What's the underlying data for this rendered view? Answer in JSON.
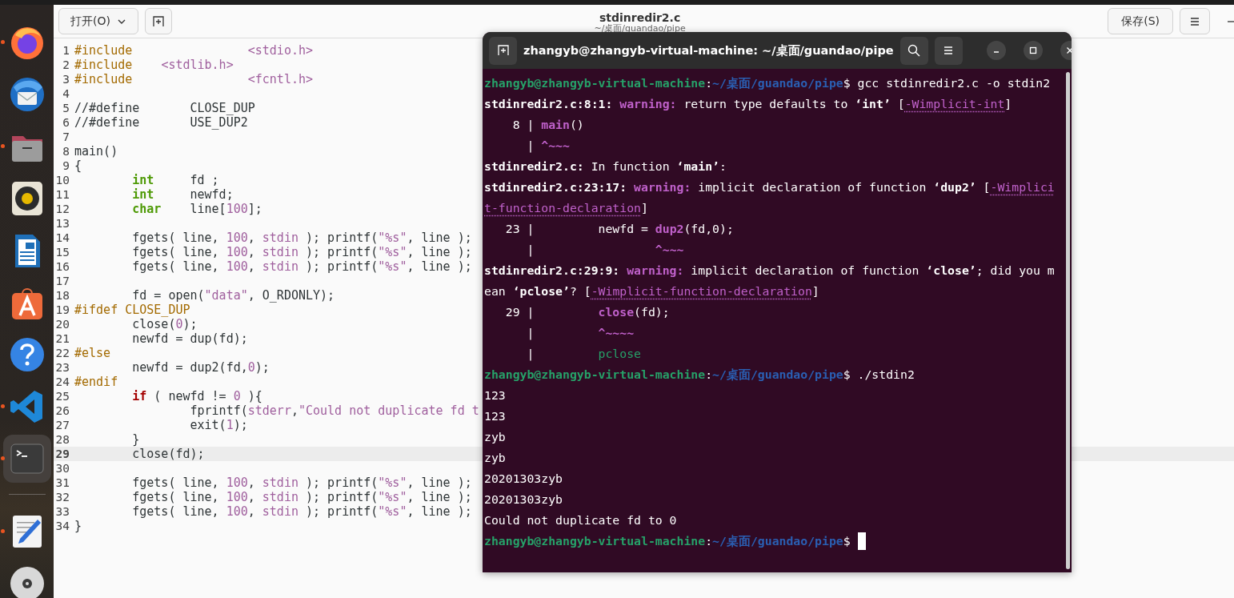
{
  "dock": [
    {
      "kind": "browser",
      "running": true,
      "selected": false
    },
    {
      "kind": "mail",
      "running": false,
      "selected": false
    },
    {
      "kind": "files",
      "running": true,
      "selected": false
    },
    {
      "kind": "music",
      "running": false,
      "selected": false
    },
    {
      "kind": "writer",
      "running": false,
      "selected": false
    },
    {
      "kind": "store",
      "running": false,
      "selected": false
    },
    {
      "kind": "help",
      "running": false,
      "selected": false
    },
    {
      "kind": "code",
      "running": true,
      "selected": false
    },
    {
      "kind": "terminal",
      "running": true,
      "selected": true
    },
    {
      "kind": "separator"
    },
    {
      "kind": "editor",
      "running": true,
      "selected": false
    },
    {
      "kind": "disc",
      "running": false,
      "selected": false
    }
  ],
  "editor": {
    "open_button": "打开(O)",
    "title": "stdinredir2.c",
    "subtitle": "~/桌面/guandao/pipe",
    "save_button": "保存(S)",
    "lines": [
      {
        "number": "1",
        "current": false,
        "segments": [
          {
            "kind": "pre",
            "text": "#include\t\t"
          },
          {
            "kind": "str",
            "text": "<stdio.h>"
          }
        ]
      },
      {
        "number": "2",
        "current": false,
        "segments": [
          {
            "kind": "pre",
            "text": "#include    "
          },
          {
            "kind": "str",
            "text": "<stdlib.h>"
          }
        ]
      },
      {
        "number": "3",
        "current": false,
        "segments": [
          {
            "kind": "pre",
            "text": "#include\t\t"
          },
          {
            "kind": "str",
            "text": "<fcntl.h>"
          }
        ]
      },
      {
        "number": "4",
        "current": false
      },
      {
        "number": "5",
        "current": false,
        "segments": [
          {
            "kind": "plain",
            "text": "//#define\tCLOSE_DUP"
          }
        ]
      },
      {
        "number": "6",
        "current": false,
        "segments": [
          {
            "kind": "plain",
            "text": "//#define\tUSE_DUP2"
          }
        ]
      },
      {
        "number": "7",
        "current": false
      },
      {
        "number": "8",
        "current": false,
        "segments": [
          {
            "kind": "plain",
            "text": "main()"
          }
        ]
      },
      {
        "number": "9",
        "current": false,
        "segments": [
          {
            "kind": "plain",
            "text": "{"
          }
        ]
      },
      {
        "number": "10",
        "current": false,
        "segments": [
          {
            "kind": "type",
            "text": "\tint"
          },
          {
            "kind": "plain",
            "text": "\tfd ;"
          }
        ]
      },
      {
        "number": "11",
        "current": false,
        "segments": [
          {
            "kind": "type",
            "text": "\tint"
          },
          {
            "kind": "plain",
            "text": "\tnewfd;"
          }
        ]
      },
      {
        "number": "12",
        "current": false,
        "segments": [
          {
            "kind": "type",
            "text": "\tchar"
          },
          {
            "kind": "plain",
            "text": "\tline["
          },
          {
            "kind": "num",
            "text": "100"
          },
          {
            "kind": "plain",
            "text": "];"
          }
        ]
      },
      {
        "number": "13",
        "current": false
      },
      {
        "number": "14",
        "current": false,
        "segments": [
          {
            "kind": "plain",
            "text": "\tfgets( line, "
          },
          {
            "kind": "num",
            "text": "100"
          },
          {
            "kind": "plain",
            "text": ", "
          },
          {
            "kind": "str",
            "text": "stdin"
          },
          {
            "kind": "plain",
            "text": " ); printf("
          },
          {
            "kind": "str",
            "text": "\"%s\""
          },
          {
            "kind": "plain",
            "text": ", line );"
          }
        ]
      },
      {
        "number": "15",
        "current": false,
        "segments": [
          {
            "kind": "plain",
            "text": "\tfgets( line, "
          },
          {
            "kind": "num",
            "text": "100"
          },
          {
            "kind": "plain",
            "text": ", "
          },
          {
            "kind": "str",
            "text": "stdin"
          },
          {
            "kind": "plain",
            "text": " ); printf("
          },
          {
            "kind": "str",
            "text": "\"%s\""
          },
          {
            "kind": "plain",
            "text": ", line );"
          }
        ]
      },
      {
        "number": "16",
        "current": false,
        "segments": [
          {
            "kind": "plain",
            "text": "\tfgets( line, "
          },
          {
            "kind": "num",
            "text": "100"
          },
          {
            "kind": "plain",
            "text": ", "
          },
          {
            "kind": "str",
            "text": "stdin"
          },
          {
            "kind": "plain",
            "text": " ); printf("
          },
          {
            "kind": "str",
            "text": "\"%s\""
          },
          {
            "kind": "plain",
            "text": ", line );"
          }
        ]
      },
      {
        "number": "17",
        "current": false
      },
      {
        "number": "18",
        "current": false,
        "segments": [
          {
            "kind": "plain",
            "text": "\tfd = open("
          },
          {
            "kind": "str",
            "text": "\"data\""
          },
          {
            "kind": "plain",
            "text": ", O_RDONLY);"
          }
        ]
      },
      {
        "number": "19",
        "current": false,
        "segments": [
          {
            "kind": "pre",
            "text": "#ifdef CLOSE_DUP"
          }
        ]
      },
      {
        "number": "20",
        "current": false,
        "segments": [
          {
            "kind": "plain",
            "text": "\tclose("
          },
          {
            "kind": "num",
            "text": "0"
          },
          {
            "kind": "plain",
            "text": ");"
          }
        ]
      },
      {
        "number": "21",
        "current": false,
        "segments": [
          {
            "kind": "plain",
            "text": "\tnewfd = dup(fd);"
          }
        ]
      },
      {
        "number": "22",
        "current": false,
        "segments": [
          {
            "kind": "pre",
            "text": "#else"
          }
        ]
      },
      {
        "number": "23",
        "current": false,
        "segments": [
          {
            "kind": "plain",
            "text": "\tnewfd = dup2(fd,"
          },
          {
            "kind": "num",
            "text": "0"
          },
          {
            "kind": "plain",
            "text": ");"
          }
        ]
      },
      {
        "number": "24",
        "current": false,
        "segments": [
          {
            "kind": "pre",
            "text": "#endif"
          }
        ]
      },
      {
        "number": "25",
        "current": false,
        "segments": [
          {
            "kind": "keyword",
            "text": "\tif"
          },
          {
            "kind": "plain",
            "text": " ( newfd != "
          },
          {
            "kind": "num",
            "text": "0"
          },
          {
            "kind": "plain",
            "text": " ){"
          }
        ]
      },
      {
        "number": "26",
        "current": false,
        "segments": [
          {
            "kind": "plain",
            "text": "\t\tfprintf("
          },
          {
            "kind": "str",
            "text": "stderr"
          },
          {
            "kind": "plain",
            "text": ","
          },
          {
            "kind": "str",
            "text": "\"Could not duplicate fd t"
          }
        ]
      },
      {
        "number": "27",
        "current": false,
        "segments": [
          {
            "kind": "plain",
            "text": "\t\texit("
          },
          {
            "kind": "num",
            "text": "1"
          },
          {
            "kind": "plain",
            "text": ");"
          }
        ]
      },
      {
        "number": "28",
        "current": false,
        "segments": [
          {
            "kind": "plain",
            "text": "\t}"
          }
        ]
      },
      {
        "number": "29",
        "current": true,
        "segments": [
          {
            "kind": "plain",
            "text": "\tclose(fd);"
          }
        ]
      },
      {
        "number": "30",
        "current": false
      },
      {
        "number": "31",
        "current": false,
        "segments": [
          {
            "kind": "plain",
            "text": "\tfgets( line, "
          },
          {
            "kind": "num",
            "text": "100"
          },
          {
            "kind": "plain",
            "text": ", "
          },
          {
            "kind": "str",
            "text": "stdin"
          },
          {
            "kind": "plain",
            "text": " ); printf("
          },
          {
            "kind": "str",
            "text": "\"%s\""
          },
          {
            "kind": "plain",
            "text": ", line );"
          }
        ]
      },
      {
        "number": "32",
        "current": false,
        "segments": [
          {
            "kind": "plain",
            "text": "\tfgets( line, "
          },
          {
            "kind": "num",
            "text": "100"
          },
          {
            "kind": "plain",
            "text": ", "
          },
          {
            "kind": "str",
            "text": "stdin"
          },
          {
            "kind": "plain",
            "text": " ); printf("
          },
          {
            "kind": "str",
            "text": "\"%s\""
          },
          {
            "kind": "plain",
            "text": ", line );"
          }
        ]
      },
      {
        "number": "33",
        "current": false,
        "segments": [
          {
            "kind": "plain",
            "text": "\tfgets( line, "
          },
          {
            "kind": "num",
            "text": "100"
          },
          {
            "kind": "plain",
            "text": ", "
          },
          {
            "kind": "str",
            "text": "stdin"
          },
          {
            "kind": "plain",
            "text": " ); printf("
          },
          {
            "kind": "str",
            "text": "\"%s\""
          },
          {
            "kind": "plain",
            "text": ", line );"
          }
        ]
      },
      {
        "number": "34",
        "current": false,
        "segments": [
          {
            "kind": "plain",
            "text": "}"
          }
        ]
      }
    ]
  },
  "terminal": {
    "title": "zhangyb@zhangyb-virtual-machine: ~/桌面/guandao/pipe",
    "lines": [
      {
        "segments": [
          {
            "kind": "user",
            "text": "zhangyb@zhangyb-virtual-machine"
          },
          {
            "kind": "plain",
            "text": ":"
          },
          {
            "kind": "path",
            "text": "~/桌面/guandao/pipe"
          },
          {
            "kind": "plain",
            "text": "$ gcc stdinredir2.c -o stdin2"
          }
        ]
      },
      {
        "segments": [
          {
            "kind": "bold",
            "text": "stdinredir2.c:8:1: "
          },
          {
            "kind": "warning",
            "text": "warning: "
          },
          {
            "kind": "plain",
            "text": "return type defaults to "
          },
          {
            "kind": "bold",
            "text": "‘int’"
          },
          {
            "kind": "plain",
            "text": " ["
          },
          {
            "kind": "flag",
            "text": "-Wimplicit-int"
          },
          {
            "kind": "plain",
            "text": "]"
          }
        ]
      },
      {
        "segments": [
          {
            "kind": "plain",
            "text": "    8 | "
          },
          {
            "kind": "mark",
            "text": "main"
          },
          {
            "kind": "plain",
            "text": "()"
          }
        ]
      },
      {
        "segments": [
          {
            "kind": "plain",
            "text": "      | "
          },
          {
            "kind": "mark",
            "text": "^~~~"
          }
        ]
      },
      {
        "segments": [
          {
            "kind": "bold",
            "text": "stdinredir2.c:"
          },
          {
            "kind": "plain",
            "text": " In function "
          },
          {
            "kind": "bold",
            "text": "‘main’"
          },
          {
            "kind": "plain",
            "text": ":"
          }
        ]
      },
      {
        "segments": [
          {
            "kind": "bold",
            "text": "stdinredir2.c:23:17: "
          },
          {
            "kind": "warning",
            "text": "warning: "
          },
          {
            "kind": "plain",
            "text": "implicit declaration of function "
          },
          {
            "kind": "bold",
            "text": "‘dup2’"
          },
          {
            "kind": "plain",
            "text": " ["
          },
          {
            "kind": "flag",
            "text": "-Wimplici"
          }
        ]
      },
      {
        "segments": [
          {
            "kind": "flag",
            "text": "t-function-declaration"
          },
          {
            "kind": "plain",
            "text": "]"
          }
        ]
      },
      {
        "segments": [
          {
            "kind": "plain",
            "text": "   23 |         newfd = "
          },
          {
            "kind": "mark",
            "text": "dup2"
          },
          {
            "kind": "plain",
            "text": "(fd,0);"
          }
        ]
      },
      {
        "segments": [
          {
            "kind": "plain",
            "text": "      |                 "
          },
          {
            "kind": "mark",
            "text": "^~~~"
          }
        ]
      },
      {
        "segments": [
          {
            "kind": "bold",
            "text": "stdinredir2.c:29:9: "
          },
          {
            "kind": "warning",
            "text": "warning: "
          },
          {
            "kind": "plain",
            "text": "implicit declaration of function "
          },
          {
            "kind": "bold",
            "text": "‘close’"
          },
          {
            "kind": "plain",
            "text": "; did you m"
          }
        ]
      },
      {
        "segments": [
          {
            "kind": "plain",
            "text": "ean "
          },
          {
            "kind": "bold",
            "text": "‘pclose’"
          },
          {
            "kind": "plain",
            "text": "? ["
          },
          {
            "kind": "flag",
            "text": "-Wimplicit-function-declaration"
          },
          {
            "kind": "plain",
            "text": "]"
          }
        ]
      },
      {
        "segments": [
          {
            "kind": "plain",
            "text": "   29 |         "
          },
          {
            "kind": "mark",
            "text": "close"
          },
          {
            "kind": "plain",
            "text": "(fd);"
          }
        ]
      },
      {
        "segments": [
          {
            "kind": "plain",
            "text": "      |         "
          },
          {
            "kind": "mark",
            "text": "^~~~~"
          }
        ]
      },
      {
        "segments": [
          {
            "kind": "plain",
            "text": "      |         "
          },
          {
            "kind": "hint",
            "text": "pclose"
          }
        ]
      },
      {
        "segments": [
          {
            "kind": "user",
            "text": "zhangyb@zhangyb-virtual-machine"
          },
          {
            "kind": "plain",
            "text": ":"
          },
          {
            "kind": "path",
            "text": "~/桌面/guandao/pipe"
          },
          {
            "kind": "plain",
            "text": "$ ./stdin2"
          }
        ]
      },
      {
        "segments": [
          {
            "kind": "plain",
            "text": "123"
          }
        ]
      },
      {
        "segments": [
          {
            "kind": "plain",
            "text": "123"
          }
        ]
      },
      {
        "segments": [
          {
            "kind": "plain",
            "text": "zyb"
          }
        ]
      },
      {
        "segments": [
          {
            "kind": "plain",
            "text": "zyb"
          }
        ]
      },
      {
        "segments": [
          {
            "kind": "plain",
            "text": "20201303zyb"
          }
        ]
      },
      {
        "segments": [
          {
            "kind": "plain",
            "text": "20201303zyb"
          }
        ]
      },
      {
        "segments": [
          {
            "kind": "plain",
            "text": "Could not duplicate fd to 0"
          }
        ]
      },
      {
        "segments": [
          {
            "kind": "user",
            "text": "zhangyb@zhangyb-virtual-machine"
          },
          {
            "kind": "plain",
            "text": ":"
          },
          {
            "kind": "path",
            "text": "~/桌面/guandao/pipe"
          },
          {
            "kind": "plain",
            "text": "$"
          }
        ],
        "cursor": true
      }
    ]
  }
}
